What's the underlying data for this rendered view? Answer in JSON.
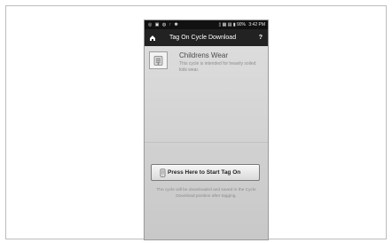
{
  "status_bar": {
    "left_icons": "◎ ▣ ◍ ↑ ✽",
    "right_icons": "▯ ▦ ▤ ▮",
    "battery": "90%",
    "time": "3:42 PM"
  },
  "app_bar": {
    "title": "Tag On Cycle Download",
    "help_label": "?"
  },
  "cycle": {
    "title": "Childrens Wear",
    "description": "This cycle is intended for heavily soiled kids wear."
  },
  "actions": {
    "start_label": "Press Here to Start Tag On"
  },
  "footer": {
    "note": "The cycle will be downloaded and saved in the Cycle Download position after tagging."
  },
  "icons": {
    "home": "home-icon",
    "help": "help-icon",
    "cycle": "laundry-icon",
    "phone": "phone-icon"
  }
}
